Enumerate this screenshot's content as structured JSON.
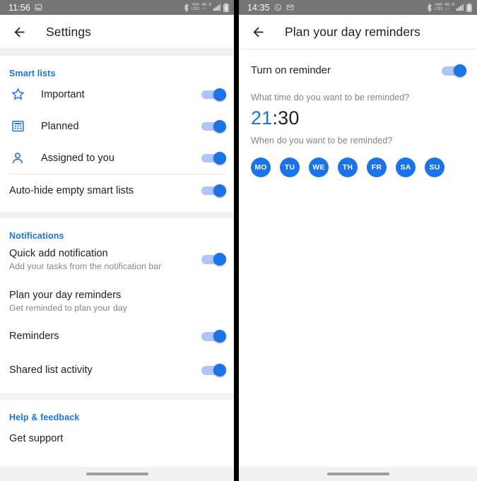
{
  "left": {
    "status_bar": {
      "time": "11:56",
      "left_icons": [
        "image-icon"
      ],
      "right_icons": [
        "bluetooth-icon",
        "volte-icon",
        "4g-icon",
        "roaming-icon",
        "signal-icon",
        "battery-icon"
      ],
      "volte_label_top": "VoO",
      "volte_label_bottom": "LTE1",
      "network_label_top": "4G",
      "network_label_bottom": "↓↑",
      "roaming_label_top": "R",
      "background": "#757575"
    },
    "appbar": {
      "back_icon": "arrow-left-icon",
      "title": "Settings"
    },
    "sections": [
      {
        "title": "Smart lists",
        "rows": [
          {
            "icon": "star-icon",
            "label": "Important",
            "sub": "",
            "toggle": true,
            "divider_after": false
          },
          {
            "icon": "calendar-icon",
            "label": "Planned",
            "sub": "",
            "toggle": true,
            "divider_after": false
          },
          {
            "icon": "person-icon",
            "label": "Assigned to you",
            "sub": "",
            "toggle": true,
            "divider_after": true
          },
          {
            "icon": "",
            "label": "Auto-hide empty smart lists",
            "sub": "",
            "toggle": true,
            "divider_after": false
          }
        ]
      },
      {
        "title": "Notifications",
        "rows": [
          {
            "icon": "",
            "label": "Quick add notification",
            "sub": "Add your tasks from the notification bar",
            "toggle": true,
            "divider_after": false
          },
          {
            "icon": "",
            "label": "Plan your day reminders",
            "sub": "Get reminded to plan your day",
            "toggle": false,
            "divider_after": false
          },
          {
            "icon": "",
            "label": "Reminders",
            "sub": "",
            "toggle": true,
            "divider_after": false
          },
          {
            "icon": "",
            "label": "Shared list activity",
            "sub": "",
            "toggle": true,
            "divider_after": false
          }
        ]
      },
      {
        "title": "Help & feedback",
        "rows": [
          {
            "icon": "",
            "label": "Get support",
            "sub": "",
            "toggle": false,
            "divider_after": false
          }
        ]
      }
    ],
    "nav_bar": {
      "handle": "gesture-pill"
    }
  },
  "right": {
    "status_bar": {
      "time": "14:35",
      "left_icons": [
        "whatsapp-icon",
        "message-icon"
      ],
      "right_icons": [
        "bluetooth-icon",
        "volte-icon",
        "4g-icon",
        "roaming-icon",
        "signal-icon",
        "battery-icon"
      ],
      "volte_label_top": "VoO",
      "volte_label_bottom": "LTE1",
      "network_label_top": "4G",
      "network_label_bottom": "↓↑",
      "roaming_label_top": "R",
      "background": "#757575"
    },
    "appbar": {
      "back_icon": "arrow-left-icon",
      "title": "Plan your day reminders"
    },
    "reminder_toggle_label": "Turn on reminder",
    "reminder_toggle_on": true,
    "time_question": "What time do you want to be reminded?",
    "time_hours": "21",
    "time_separator": ":",
    "time_minutes": "30",
    "days_question": "When do you want to be reminded?",
    "days": [
      {
        "label": "MO",
        "selected": true
      },
      {
        "label": "TU",
        "selected": true
      },
      {
        "label": "WE",
        "selected": true
      },
      {
        "label": "TH",
        "selected": true
      },
      {
        "label": "FR",
        "selected": true
      },
      {
        "label": "SA",
        "selected": true
      },
      {
        "label": "SU",
        "selected": true
      }
    ],
    "nav_bar": {
      "handle": "gesture-pill"
    }
  },
  "colors": {
    "accent": "#1a73e8",
    "track": "#aec5f5",
    "text_primary": "#202124",
    "text_secondary": "#80868b",
    "status_bar": "#757575",
    "band": "#f1f1f1"
  }
}
